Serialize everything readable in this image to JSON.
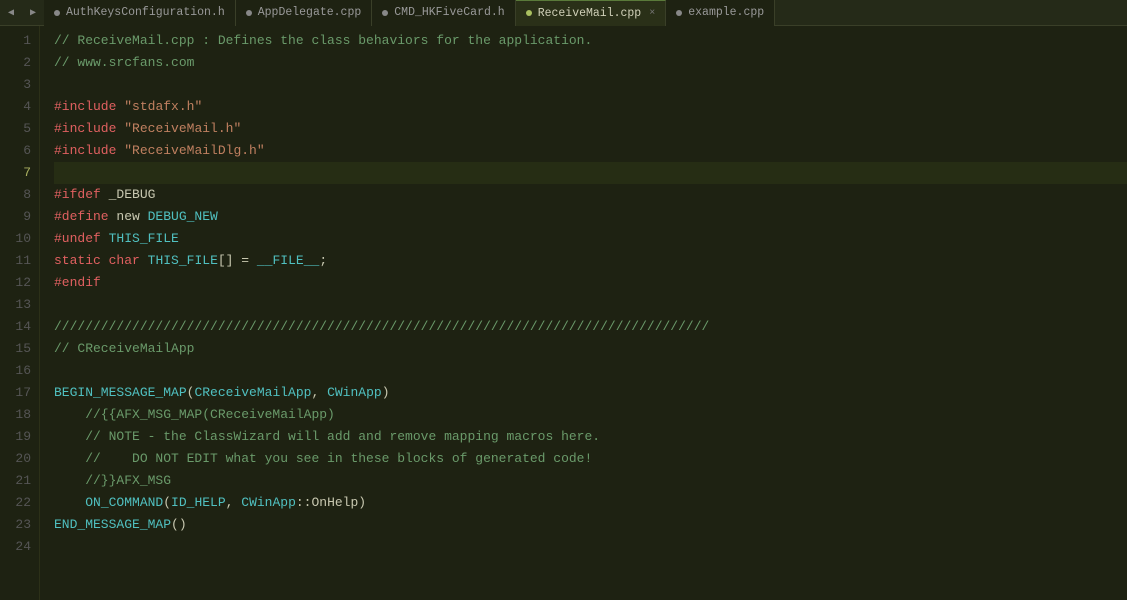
{
  "tabs": [
    {
      "label": "AuthKeysConfiguration.h",
      "active": false,
      "dot": true,
      "close": false
    },
    {
      "label": "AppDelegate.cpp",
      "active": false,
      "dot": true,
      "close": false
    },
    {
      "label": "CMD_HKFiveCard.h",
      "active": false,
      "dot": true,
      "close": false
    },
    {
      "label": "ReceiveMail.cpp",
      "active": true,
      "dot": true,
      "close": true
    },
    {
      "label": "example.cpp",
      "active": false,
      "dot": true,
      "close": false
    }
  ],
  "active_line": 7,
  "lines": [
    {
      "n": 1,
      "code": "// ReceiveMail.cpp : Defines the class behaviors for the application."
    },
    {
      "n": 2,
      "code": "// www.srcfans.com"
    },
    {
      "n": 3,
      "code": ""
    },
    {
      "n": 4,
      "code": "#include \"stdafx.h\""
    },
    {
      "n": 5,
      "code": "#include \"ReceiveMail.h\""
    },
    {
      "n": 6,
      "code": "#include \"ReceiveMailDlg.h\""
    },
    {
      "n": 7,
      "code": ""
    },
    {
      "n": 8,
      "code": "#ifdef _DEBUG"
    },
    {
      "n": 9,
      "code": "#define new DEBUG_NEW"
    },
    {
      "n": 10,
      "code": "#undef THIS_FILE"
    },
    {
      "n": 11,
      "code": "static char THIS_FILE[] = __FILE__;"
    },
    {
      "n": 12,
      "code": "#endif"
    },
    {
      "n": 13,
      "code": ""
    },
    {
      "n": 14,
      "code": "////////////////////////////////////////////////////////////////////////////////////"
    },
    {
      "n": 15,
      "code": "// CReceiveMailApp"
    },
    {
      "n": 16,
      "code": ""
    },
    {
      "n": 17,
      "code": "BEGIN_MESSAGE_MAP(CReceiveMailApp, CWinApp)"
    },
    {
      "n": 18,
      "code": "    //{{AFX_MSG_MAP(CReceiveMailApp)"
    },
    {
      "n": 19,
      "code": "    // NOTE - the ClassWizard will add and remove mapping macros here."
    },
    {
      "n": 20,
      "code": "    //    DO NOT EDIT what you see in these blocks of generated code!"
    },
    {
      "n": 21,
      "code": "    //}}AFX_MSG"
    },
    {
      "n": 22,
      "code": "    ON_COMMAND(ID_HELP, CWinApp::OnHelp)"
    },
    {
      "n": 23,
      "code": "END_MESSAGE_MAP()"
    },
    {
      "n": 24,
      "code": ""
    }
  ]
}
